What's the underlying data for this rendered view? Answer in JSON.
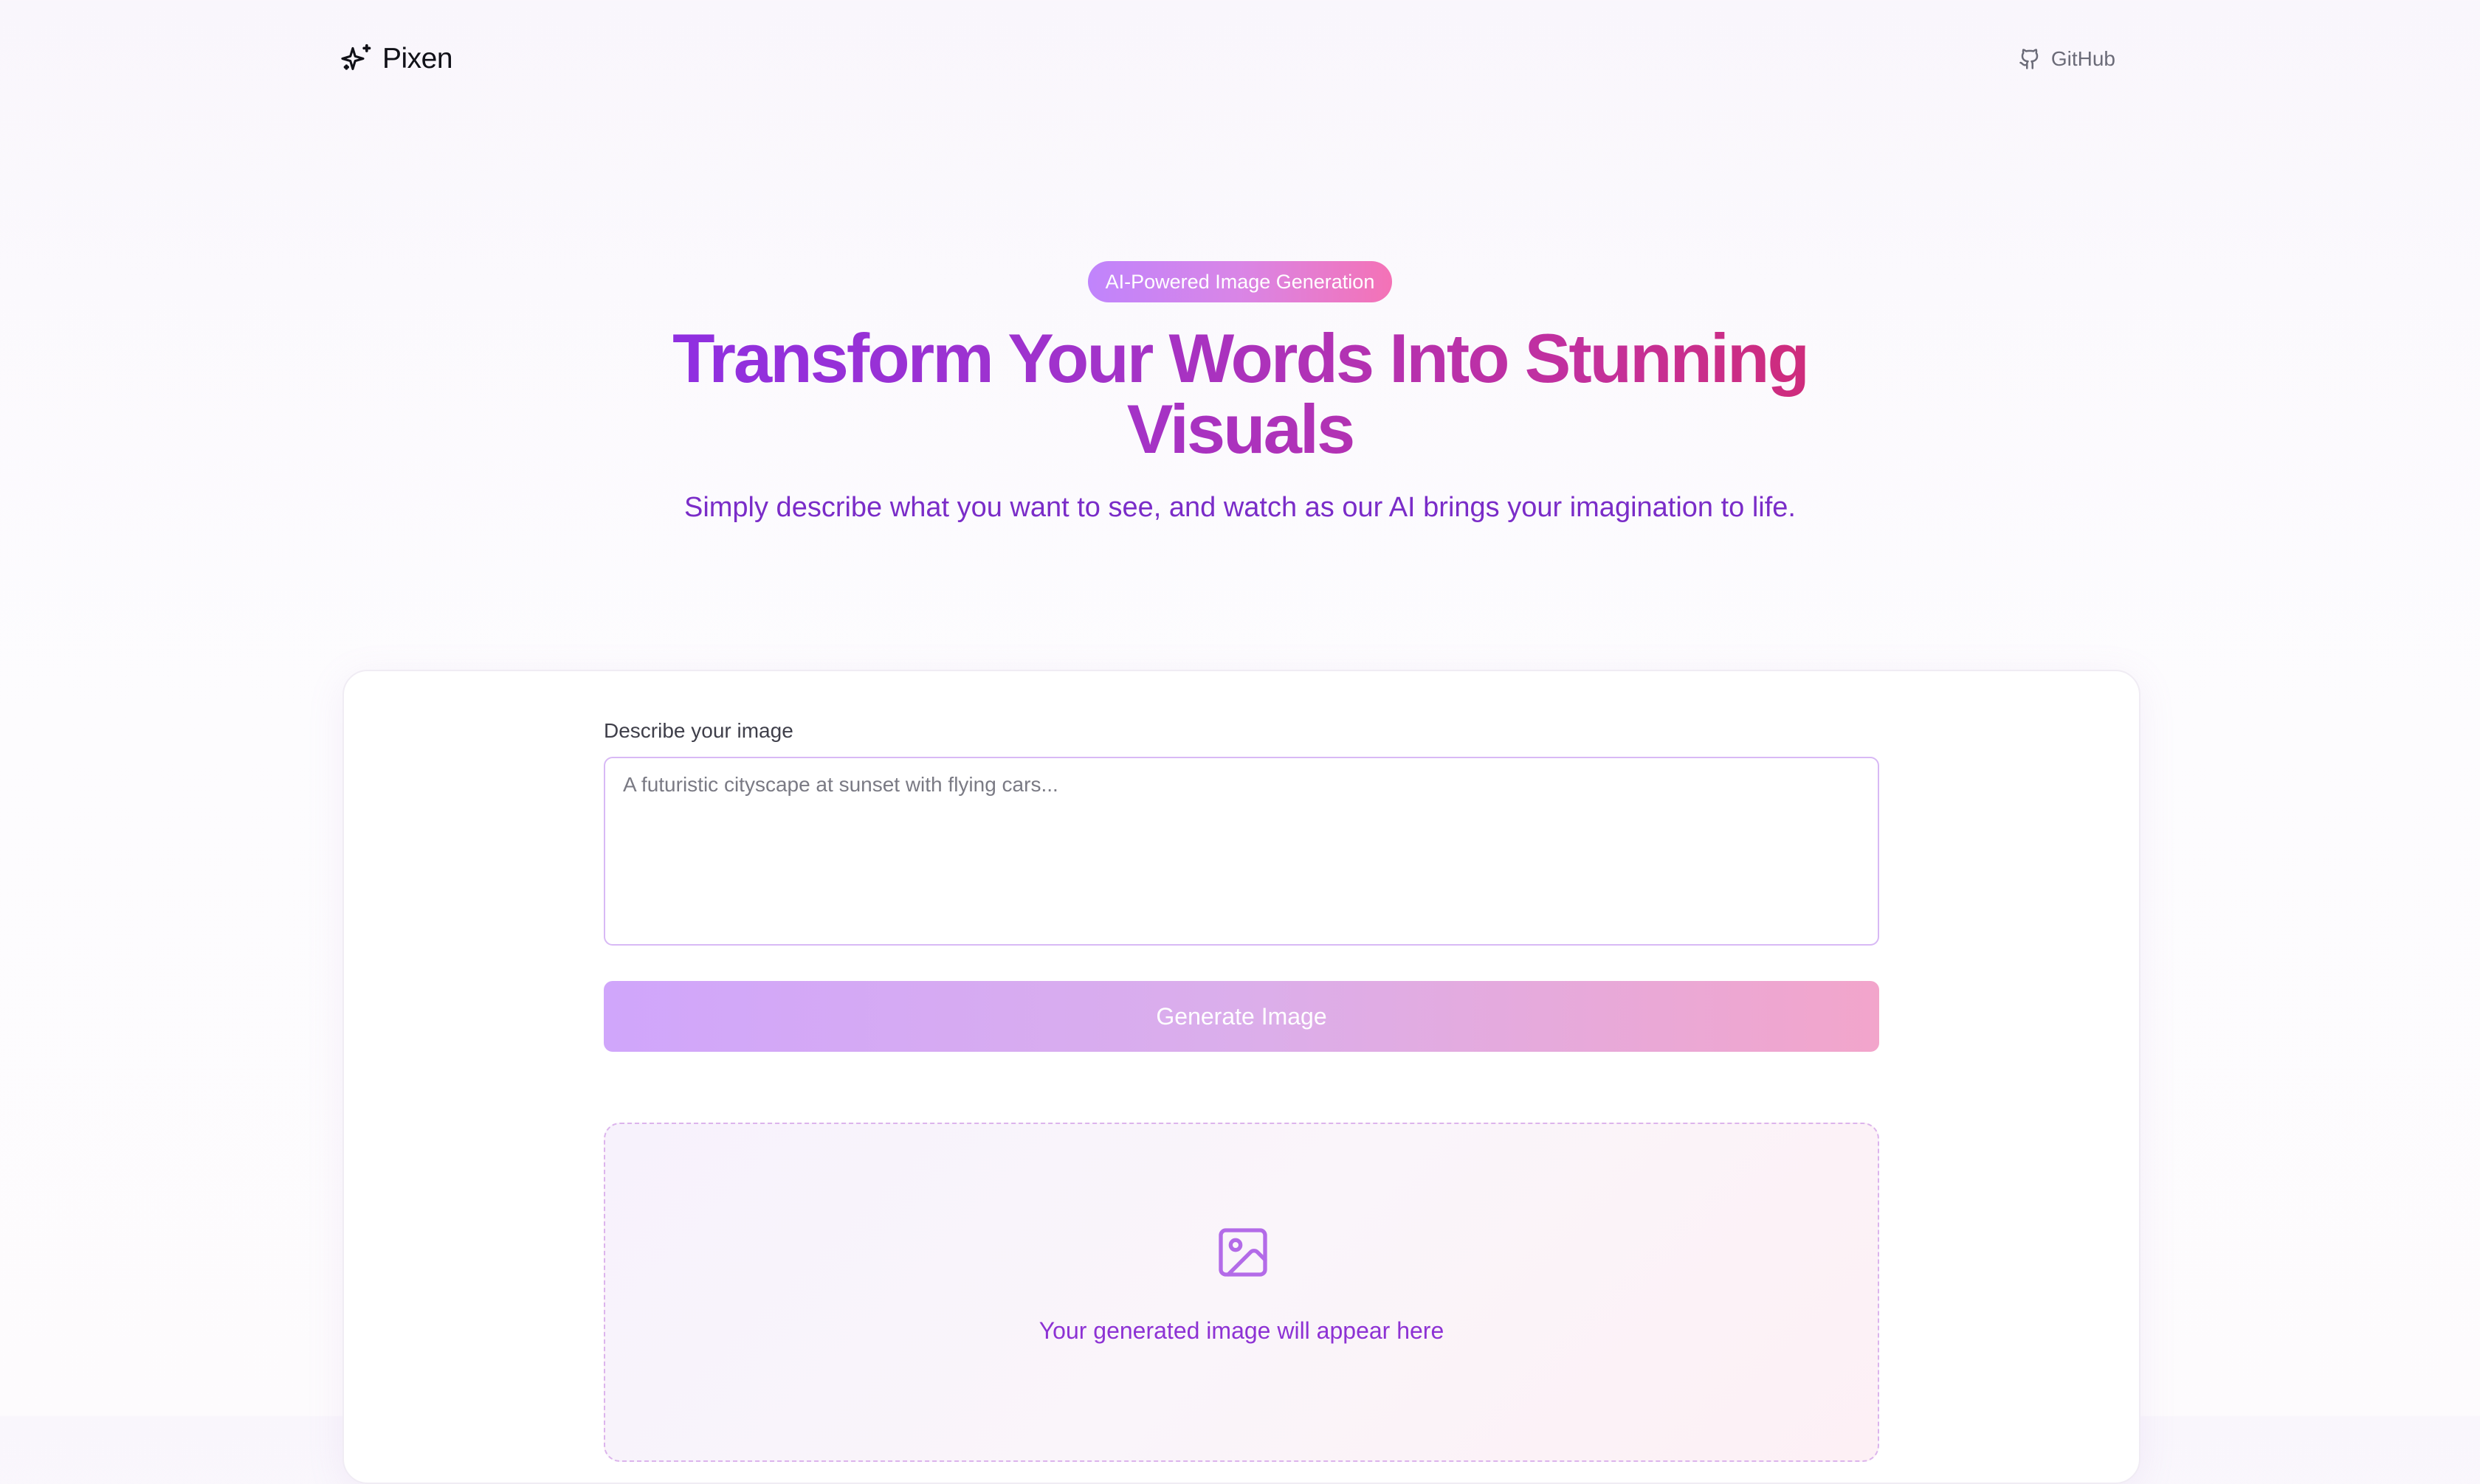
{
  "header": {
    "brand_name": "Pixen",
    "brand_icon": "sparkles-icon",
    "github_label": "GitHub",
    "github_icon": "github-icon"
  },
  "hero": {
    "badge": "AI-Powered Image Generation",
    "headline": "Transform Your Words Into Stunning Visuals",
    "subtitle": "Simply describe what you want to see, and watch as our AI brings your imagination to life."
  },
  "form": {
    "prompt_label": "Describe your image",
    "prompt_placeholder": "A futuristic cityscape at sunset with flying cars...",
    "prompt_value": "",
    "generate_label": "Generate Image"
  },
  "preview": {
    "icon": "image-icon",
    "empty_text": "Your generated image will appear here"
  },
  "colors": {
    "accent_purple": "#8b2ee6",
    "accent_pink": "#f472b6",
    "heading_gradient_start": "#8b2ee6",
    "heading_gradient_end": "#d42a6e",
    "subtitle": "#7a2cc8"
  }
}
